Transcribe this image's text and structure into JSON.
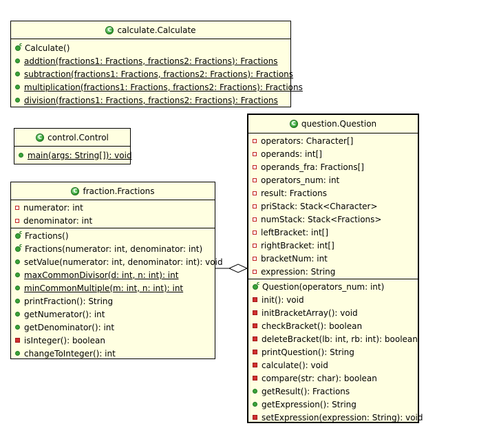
{
  "classes": {
    "calculate": {
      "title": "calculate.Calculate",
      "members": [
        {
          "icon": "ctor",
          "text": "Calculate()",
          "static": false
        },
        {
          "icon": "pub",
          "text": "addtion(fractions1: Fractions, fractions2: Fractions): Fractions",
          "static": true
        },
        {
          "icon": "pub",
          "text": "subtraction(fractions1: Fractions, fractions2: Fractions): Fractions",
          "static": true
        },
        {
          "icon": "pub",
          "text": "multiplication(fractions1: Fractions, fractions2: Fractions): Fractions",
          "static": true
        },
        {
          "icon": "pub",
          "text": "division(fractions1: Fractions, fractions2: Fractions): Fractions",
          "static": true
        }
      ]
    },
    "control": {
      "title": "control.Control",
      "members": [
        {
          "icon": "pub",
          "text": "main(args: String[]): void",
          "static": true
        }
      ]
    },
    "fraction": {
      "title": "fraction.Fractions",
      "fields": [
        {
          "icon": "priv-field",
          "text": "numerator: int"
        },
        {
          "icon": "priv-field",
          "text": "denominator: int"
        }
      ],
      "methods": [
        {
          "icon": "ctor",
          "text": "Fractions()",
          "static": false
        },
        {
          "icon": "ctor",
          "text": "Fractions(numerator: int, denominator: int)",
          "static": false
        },
        {
          "icon": "pub",
          "text": "setValue(numerator: int, denominator: int): void",
          "static": false
        },
        {
          "icon": "pub",
          "text": "maxCommonDivisor(d: int, n: int): int",
          "static": true
        },
        {
          "icon": "pub",
          "text": "minCommonMultiple(m: int, n: int): int",
          "static": true
        },
        {
          "icon": "pub",
          "text": "printFraction(): String",
          "static": false
        },
        {
          "icon": "pub",
          "text": "getNumerator(): int",
          "static": false
        },
        {
          "icon": "pub",
          "text": "getDenominator(): int",
          "static": false
        },
        {
          "icon": "priv-m",
          "text": "isInteger(): boolean",
          "static": false
        },
        {
          "icon": "pub",
          "text": "changeToInteger(): int",
          "static": false
        }
      ]
    },
    "question": {
      "title": "question.Question",
      "fields": [
        {
          "icon": "priv-field",
          "text": "operators: Character[]"
        },
        {
          "icon": "priv-field",
          "text": "operands: int[]"
        },
        {
          "icon": "priv-field",
          "text": "operands_fra: Fractions[]"
        },
        {
          "icon": "priv-field",
          "text": "operators_num: int"
        },
        {
          "icon": "priv-field",
          "text": "result: Fractions"
        },
        {
          "icon": "priv-field",
          "text": "priStack: Stack<Character>"
        },
        {
          "icon": "priv-field",
          "text": "numStack: Stack<Fractions>"
        },
        {
          "icon": "priv-field",
          "text": "leftBracket: int[]"
        },
        {
          "icon": "priv-field",
          "text": "rightBracket: int[]"
        },
        {
          "icon": "priv-field",
          "text": "bracketNum: int"
        },
        {
          "icon": "priv-field",
          "text": "expression: String"
        }
      ],
      "methods": [
        {
          "icon": "ctor",
          "text": "Question(operators_num: int)",
          "static": false
        },
        {
          "icon": "priv-m",
          "text": "init(): void",
          "static": false
        },
        {
          "icon": "priv-m",
          "text": "initBracketArray(): void",
          "static": false
        },
        {
          "icon": "priv-m",
          "text": "checkBracket(): boolean",
          "static": false
        },
        {
          "icon": "priv-m",
          "text": "deleteBracket(lb: int, rb: int): boolean",
          "static": false
        },
        {
          "icon": "priv-m",
          "text": "printQuestion(): String",
          "static": false
        },
        {
          "icon": "priv-m",
          "text": "calculate(): void",
          "static": false
        },
        {
          "icon": "priv-m",
          "text": "compare(str: char): boolean",
          "static": false
        },
        {
          "icon": "pub",
          "text": "getResult(): Fractions",
          "static": false
        },
        {
          "icon": "pub",
          "text": "getExpression(): String",
          "static": false
        },
        {
          "icon": "priv-m",
          "text": "setExpression(expression: String): void",
          "static": false
        }
      ]
    }
  }
}
